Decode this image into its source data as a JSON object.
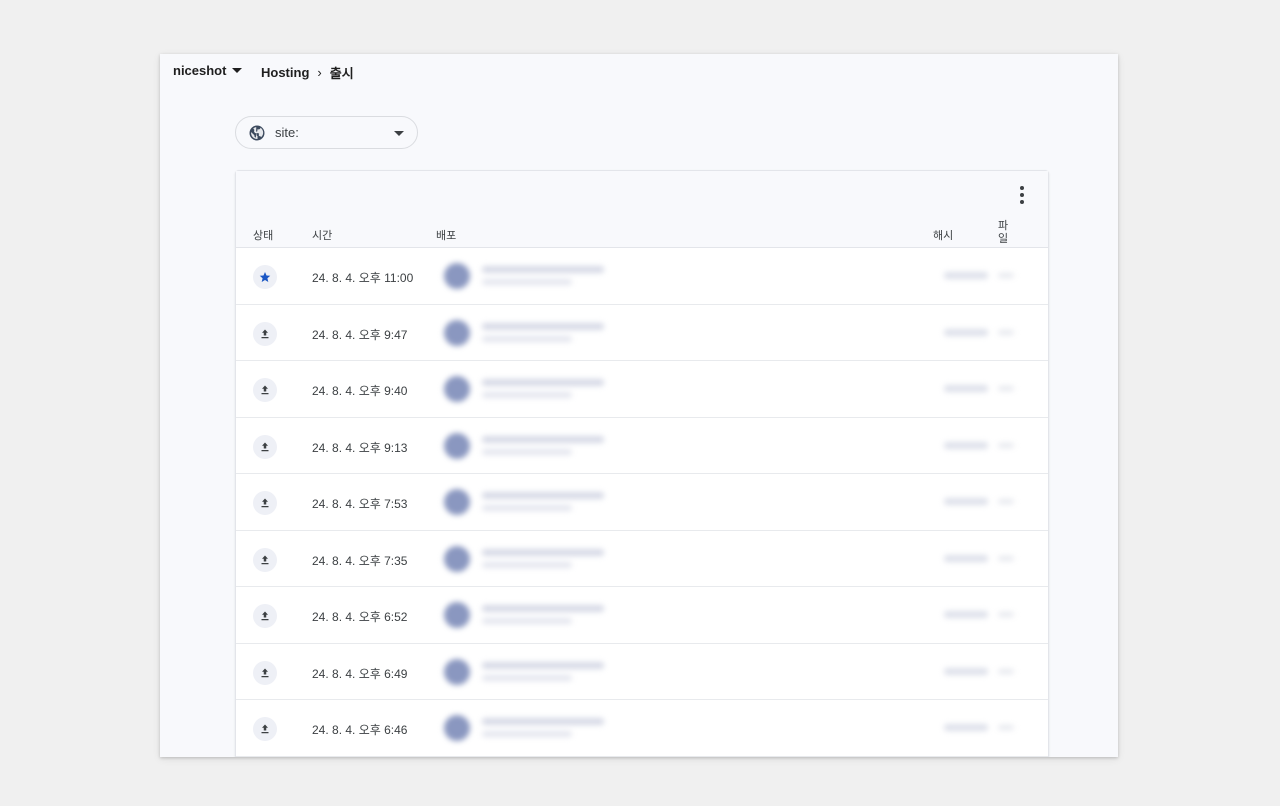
{
  "topbar": {
    "project": "niceshot",
    "breadcrumb": [
      "Hosting",
      "출시"
    ],
    "breadcrumb_separator": "›"
  },
  "site_filter": {
    "label": "site:",
    "icon": "globe-icon"
  },
  "table": {
    "columns": {
      "status": "상태",
      "time": "시간",
      "deploy": "배포",
      "hash": "해시",
      "files": "파일"
    },
    "rows": [
      {
        "status_icon": "star-icon",
        "time": "24. 8. 4. 오후 11:00"
      },
      {
        "status_icon": "upload-icon",
        "time": "24. 8. 4. 오후 9:47"
      },
      {
        "status_icon": "upload-icon",
        "time": "24. 8. 4. 오후 9:40"
      },
      {
        "status_icon": "upload-icon",
        "time": "24. 8. 4. 오후 9:13"
      },
      {
        "status_icon": "upload-icon",
        "time": "24. 8. 4. 오후 7:53"
      },
      {
        "status_icon": "upload-icon",
        "time": "24. 8. 4. 오후 7:35"
      },
      {
        "status_icon": "upload-icon",
        "time": "24. 8. 4. 오후 6:52"
      },
      {
        "status_icon": "upload-icon",
        "time": "24. 8. 4. 오후 6:49"
      },
      {
        "status_icon": "upload-icon",
        "time": "24. 8. 4. 오후 6:46"
      }
    ]
  },
  "colors": {
    "star": "#1a56c4",
    "upload": "#3c4043",
    "avatar_blur": "#8a97c0"
  }
}
